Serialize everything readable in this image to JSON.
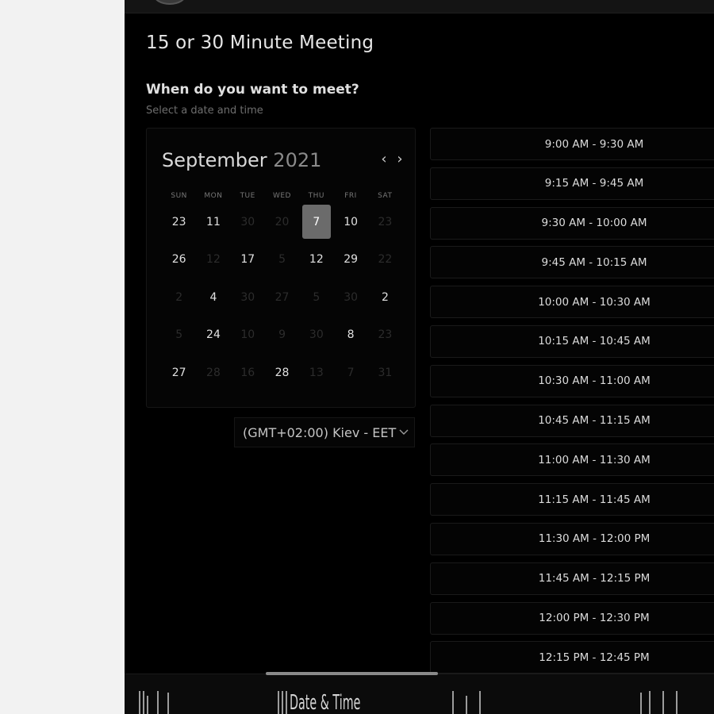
{
  "page": {
    "meeting_title": "15 or 30 Minute Meeting",
    "question": "When do you want to meet?",
    "subtitle": "Select a date and time"
  },
  "calendar": {
    "month": "September",
    "year": "2021",
    "prev_icon": "chevron-left-icon",
    "next_icon": "chevron-right-icon",
    "weekdays": [
      "SUN",
      "MON",
      "TUE",
      "WED",
      "THU",
      "FRI",
      "SAT"
    ],
    "weeks": [
      [
        {
          "d": "23",
          "m": false
        },
        {
          "d": "11",
          "m": false
        },
        {
          "d": "30",
          "m": true
        },
        {
          "d": "20",
          "m": true
        },
        {
          "d": "7",
          "m": false,
          "sel": true
        },
        {
          "d": "10",
          "m": false
        },
        {
          "d": "23",
          "m": true
        }
      ],
      [
        {
          "d": "26",
          "m": false
        },
        {
          "d": "12",
          "m": true
        },
        {
          "d": "17",
          "m": false
        },
        {
          "d": "5",
          "m": true
        },
        {
          "d": "12",
          "m": false
        },
        {
          "d": "29",
          "m": false
        },
        {
          "d": "22",
          "m": true
        }
      ],
      [
        {
          "d": "2",
          "m": true
        },
        {
          "d": "4",
          "m": false
        },
        {
          "d": "30",
          "m": true
        },
        {
          "d": "27",
          "m": true
        },
        {
          "d": "5",
          "m": true
        },
        {
          "d": "30",
          "m": true
        },
        {
          "d": "2",
          "m": false
        }
      ],
      [
        {
          "d": "5",
          "m": true
        },
        {
          "d": "24",
          "m": false
        },
        {
          "d": "10",
          "m": true
        },
        {
          "d": "9",
          "m": true
        },
        {
          "d": "30",
          "m": true
        },
        {
          "d": "8",
          "m": false
        },
        {
          "d": "23",
          "m": true
        }
      ],
      [
        {
          "d": "27",
          "m": false
        },
        {
          "d": "28",
          "m": true
        },
        {
          "d": "16",
          "m": true
        },
        {
          "d": "28",
          "m": false
        },
        {
          "d": "13",
          "m": true
        },
        {
          "d": "7",
          "m": true
        },
        {
          "d": "31",
          "m": true
        }
      ]
    ],
    "selected_day": "7"
  },
  "timezone": {
    "value": "(GMT+02:00) Kiev - EET",
    "icon": "chevron-down-icon"
  },
  "time_slots": [
    "9:00 AM - 9:30 AM",
    "9:15 AM - 9:45 AM",
    "9:30 AM - 10:00 AM",
    "9:45 AM - 10:15 AM",
    "10:00 AM - 10:30 AM",
    "10:15 AM - 10:45 AM",
    "10:30 AM - 11:00 AM",
    "10:45 AM - 11:15 AM",
    "11:00 AM - 11:30 AM",
    "11:15 AM - 11:45 AM",
    "11:30 AM - 12:00 PM",
    "11:45 AM - 12:15 PM",
    "12:00 PM - 12:30 PM",
    "12:15 PM - 12:45 PM"
  ],
  "steps": {
    "active_label": "Date & Time"
  },
  "colors": {
    "background": "#000000",
    "selected_day": "#6b6b6b",
    "text": "#e0e0e0",
    "muted": "#2c2c2c"
  }
}
